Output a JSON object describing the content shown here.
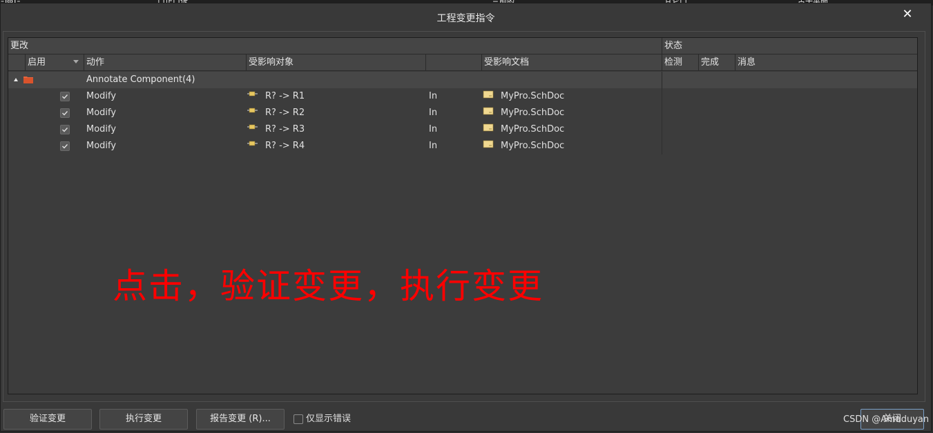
{
  "dialog": {
    "title": "工程变更指令",
    "close_glyph": "✕"
  },
  "background_strip": {
    "segments": [
      "ΞΙΦΊΞ",
      "ㄇ止ㄇ诉",
      "三前的",
      "甘它口",
      "占于平面"
    ]
  },
  "table": {
    "section_headers": {
      "changes": "更改",
      "status": "状态"
    },
    "columns": {
      "enable": "启用",
      "action": "动作",
      "affected_object": "受影响对象",
      "affected_document": "受影响文档",
      "check": "检测",
      "done": "完成",
      "message": "消息"
    },
    "group": {
      "label": "Annotate Component(4)"
    },
    "rows": [
      {
        "action": "Modify",
        "object": "R? -> R1",
        "dir": "In",
        "document": "MyPro.SchDoc"
      },
      {
        "action": "Modify",
        "object": "R? -> R2",
        "dir": "In",
        "document": "MyPro.SchDoc"
      },
      {
        "action": "Modify",
        "object": "R? -> R3",
        "dir": "In",
        "document": "MyPro.SchDoc"
      },
      {
        "action": "Modify",
        "object": "R? -> R4",
        "dir": "In",
        "document": "MyPro.SchDoc"
      }
    ]
  },
  "annotation": "点击，验证变更，执行变更",
  "footer": {
    "validate_label": "验证变更",
    "execute_label": "执行变更",
    "report_label": "报告变更 (R)...",
    "only_errors_label": "仅显示错误",
    "close_label": "关闭"
  },
  "watermark": "CSDN @Amaduyan",
  "colors": {
    "annotation": "#ff0000",
    "dialog_bg": "#393939",
    "folder": "#e8643c",
    "icon_yellow": "#e8c860"
  }
}
